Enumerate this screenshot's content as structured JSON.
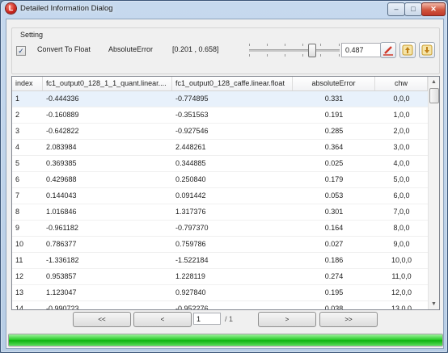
{
  "window": {
    "title": "Detailed Information Dialog",
    "min": "–",
    "max": "□",
    "close": "✕",
    "icon_letter": "L"
  },
  "setting": {
    "group_label": "Setting",
    "checkbox_checked": true,
    "checkbox_label": "Convert To Float",
    "metric_label": "AbsoluteError",
    "range": "[0.201 , 0.658]",
    "slider_level": 0.7,
    "value": "0.487"
  },
  "table": {
    "headers": [
      "index",
      "fc1_output0_128_1_1_quant.linear....",
      "fc1_output0_128_caffe.linear.float",
      "absoluteError",
      "chw"
    ],
    "rows": [
      [
        "1",
        "-0.444336",
        "-0.774895",
        "0.331",
        "0,0,0"
      ],
      [
        "2",
        "-0.160889",
        "-0.351563",
        "0.191",
        "1,0,0"
      ],
      [
        "3",
        "-0.642822",
        "-0.927546",
        "0.285",
        "2,0,0"
      ],
      [
        "4",
        "2.083984",
        "2.448261",
        "0.364",
        "3,0,0"
      ],
      [
        "5",
        "0.369385",
        "0.344885",
        "0.025",
        "4,0,0"
      ],
      [
        "6",
        "0.429688",
        "0.250840",
        "0.179",
        "5,0,0"
      ],
      [
        "7",
        "0.144043",
        "0.091442",
        "0.053",
        "6,0,0"
      ],
      [
        "8",
        "1.016846",
        "1.317376",
        "0.301",
        "7,0,0"
      ],
      [
        "9",
        "-0.961182",
        "-0.797370",
        "0.164",
        "8,0,0"
      ],
      [
        "10",
        "0.786377",
        "0.759786",
        "0.027",
        "9,0,0"
      ],
      [
        "11",
        "-1.336182",
        "-1.522184",
        "0.186",
        "10,0,0"
      ],
      [
        "12",
        "0.953857",
        "1.228119",
        "0.274",
        "11,0,0"
      ],
      [
        "13",
        "1.123047",
        "0.927840",
        "0.195",
        "12,0,0"
      ],
      [
        "14",
        "-0.990723",
        "-0.952276",
        "0.038",
        "13,0,0"
      ]
    ]
  },
  "pager": {
    "first": "<<",
    "prev": "<",
    "page": "1",
    "total": "/ 1",
    "next": ">",
    "last": ">>"
  },
  "progress": {
    "fraction": 1.0
  },
  "colors": {
    "accent_red": "#d23a2a",
    "progress_green": "#2fce2f",
    "selected_row": "#e8f1fb"
  }
}
